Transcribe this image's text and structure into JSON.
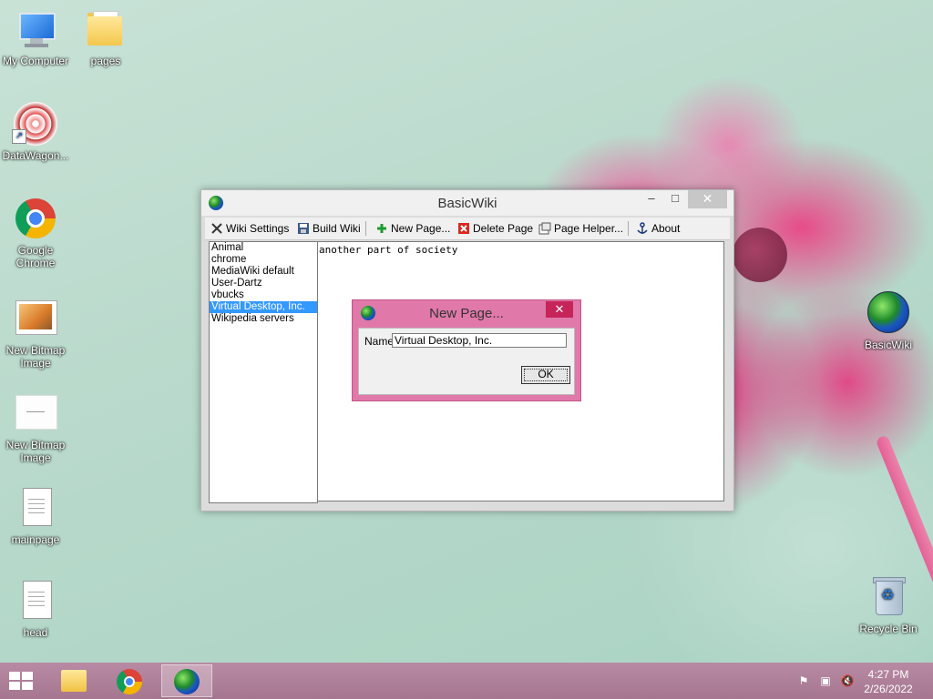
{
  "desktop": {
    "icons": [
      {
        "label": "My Computer",
        "icon": "computer-icon"
      },
      {
        "label": "pages",
        "icon": "folder-icon"
      },
      {
        "label": "DataWagon...",
        "icon": "datawagon-icon"
      },
      {
        "label": "Google Chrome",
        "icon": "chrome-icon"
      },
      {
        "label": "New Bitmap Image",
        "icon": "bitmap-icon"
      },
      {
        "label": "New Bitmap Image",
        "icon": "bitmap-icon"
      },
      {
        "label": "mainpage",
        "icon": "document-icon"
      },
      {
        "label": "head",
        "icon": "document-icon"
      },
      {
        "label": "BasicWiki",
        "icon": "globe-icon"
      },
      {
        "label": "Recycle Bin",
        "icon": "recycle-bin-icon"
      }
    ]
  },
  "window": {
    "title": "BasicWiki",
    "min_glyph": "–",
    "max_glyph": "□",
    "close_glyph": "✕",
    "toolbar": {
      "wiki_settings": "Wiki Settings",
      "build_wiki": "Build Wiki",
      "new_page": "New Page...",
      "delete_page": "Delete Page",
      "page_helper": "Page Helper...",
      "about": "About"
    },
    "pages": [
      "Animal",
      "chrome",
      "MediaWiki default",
      "User-Dartz",
      "vbucks",
      "Virtual Desktop, Inc.",
      "Wikipedia servers"
    ],
    "selected_page": "Virtual Desktop, Inc.",
    "editor_text": "another part of society"
  },
  "dialog": {
    "title": "New Page...",
    "close_glyph": "✕",
    "name_label": "Name",
    "name_value": "Virtual Desktop, Inc.",
    "ok_label": "OK"
  },
  "taskbar": {
    "clock_time": "4:27 PM",
    "clock_date": "2/26/2022"
  },
  "colors": {
    "selection": "#3399ff",
    "dialog_frame": "#e079a9",
    "taskbar": "#b88aa3"
  }
}
